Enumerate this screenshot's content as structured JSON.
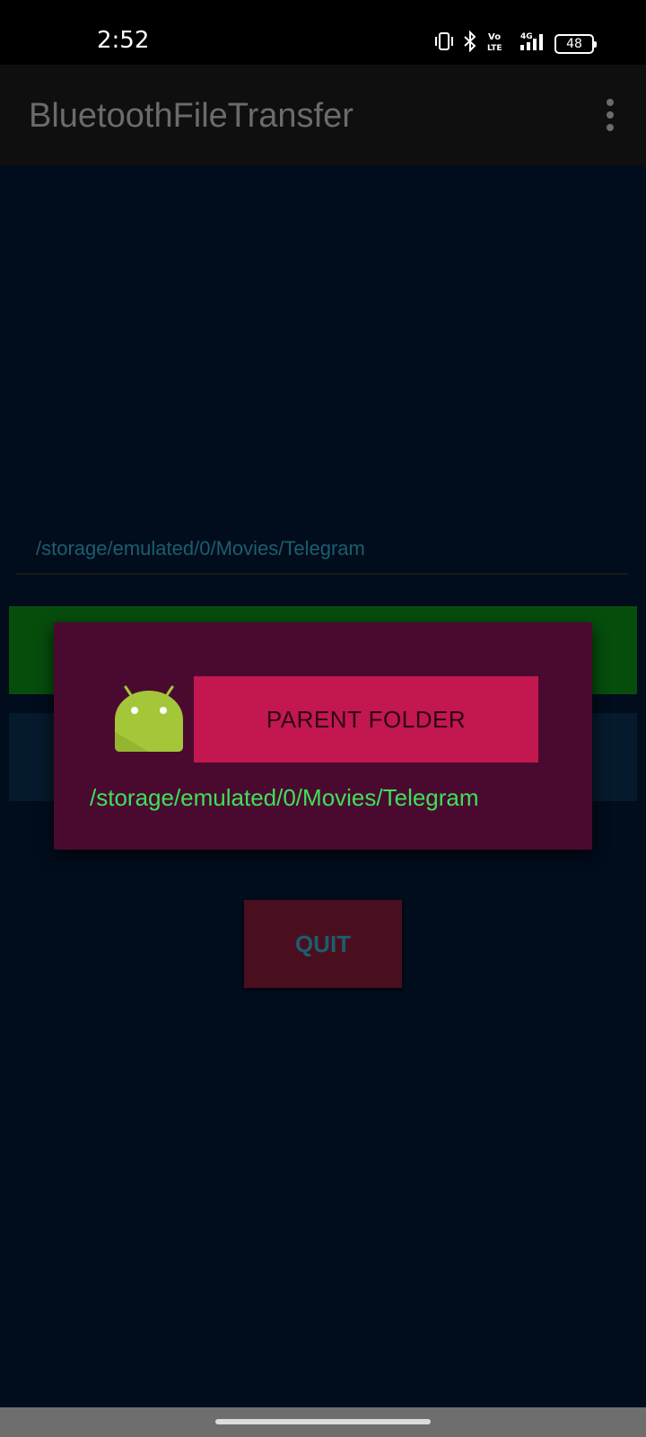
{
  "status_bar": {
    "time": "2:52",
    "battery_level": "48",
    "network_label": "4G",
    "volte_label_top": "Vo",
    "volte_label_bottom": "LTE",
    "icons": [
      "vibrate-icon",
      "bluetooth-icon",
      "volte-icon",
      "signal-4g-icon",
      "battery-icon"
    ]
  },
  "app_bar": {
    "title": "BluetoothFileTransfer",
    "menu_icon": "more-vert-icon"
  },
  "main": {
    "path_text": "/storage/emulated/0/Movies/Telegram",
    "quit_label": "QUIT"
  },
  "dialog": {
    "icon": "android-robot-icon",
    "parent_folder_label": "PARENT FOLDER",
    "path_text": "/storage/emulated/0/Movies/Telegram"
  },
  "colors": {
    "background": "#010c1c",
    "app_bar": "#0f0f0f",
    "dialog_bg": "#4a0a30",
    "parent_button": "#c2174f",
    "dialog_path_text": "#3ee05a",
    "green_button": "#064d0c",
    "quit_button": "#4a0f1e"
  }
}
